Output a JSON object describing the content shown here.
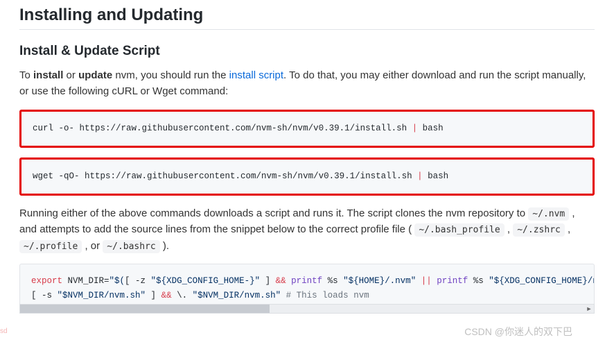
{
  "heading": "Installing and Updating",
  "subheading": "Install & Update Script",
  "intro": {
    "pre": "To ",
    "bold1": "install",
    "mid1": " or ",
    "bold2": "update",
    "mid2": " nvm, you should run the ",
    "link": "install script",
    "post": ". To do that, you may either download and run the script manually, or use the following cURL or Wget command:"
  },
  "cmd_curl": {
    "cmd": "curl -o- https://raw.githubusercontent.com/nvm-sh/nvm/v0.39.1/install.sh",
    "pipe": " | ",
    "tail": "bash"
  },
  "cmd_wget": {
    "cmd": "wget -qO- https://raw.githubusercontent.com/nvm-sh/nvm/v0.39.1/install.sh",
    "pipe": " | ",
    "tail": "bash"
  },
  "para2": {
    "pre": "Running either of the above commands downloads a script and runs it. The script clones the nvm repository to ",
    "c1": "~/.nvm",
    "mid1": " , and attempts to add the source lines from the snippet below to the correct profile file ( ",
    "c2": "~/.bash_profile",
    "sep1": " , ",
    "c3": "~/.zshrc",
    "sep2": " , ",
    "c4": "~/.profile",
    "or": " , or ",
    "c5": "~/.bashrc",
    "end": " )."
  },
  "snippet": {
    "l1": {
      "kw": "export",
      "a": " NVM_DIR=",
      "s1": "\"$(",
      "b": "[ -z ",
      "s2": "\"${XDG_CONFIG_HOME-}\"",
      "c": " ] ",
      "op1": "&&",
      "d": " ",
      "fn1": "printf",
      "e": " %s ",
      "s3": "\"${HOME}/.nvm\"",
      "f": " ",
      "op2": "||",
      "g": " ",
      "fn2": "printf",
      "h": " %s ",
      "s4": "\"${XDG_CONFIG_HOME}/n"
    },
    "l2": {
      "a": "[ -s ",
      "s1": "\"$NVM_DIR/nvm.sh\"",
      "b": " ] ",
      "op1": "&&",
      "c": " ",
      "bs": "\\.",
      "d": " ",
      "s2": "\"$NVM_DIR/nvm.sh\"",
      "e": " ",
      "cmt": "# This loads nvm"
    }
  },
  "watermark": "CSDN @你迷人的双下巴",
  "tiny": "sd"
}
